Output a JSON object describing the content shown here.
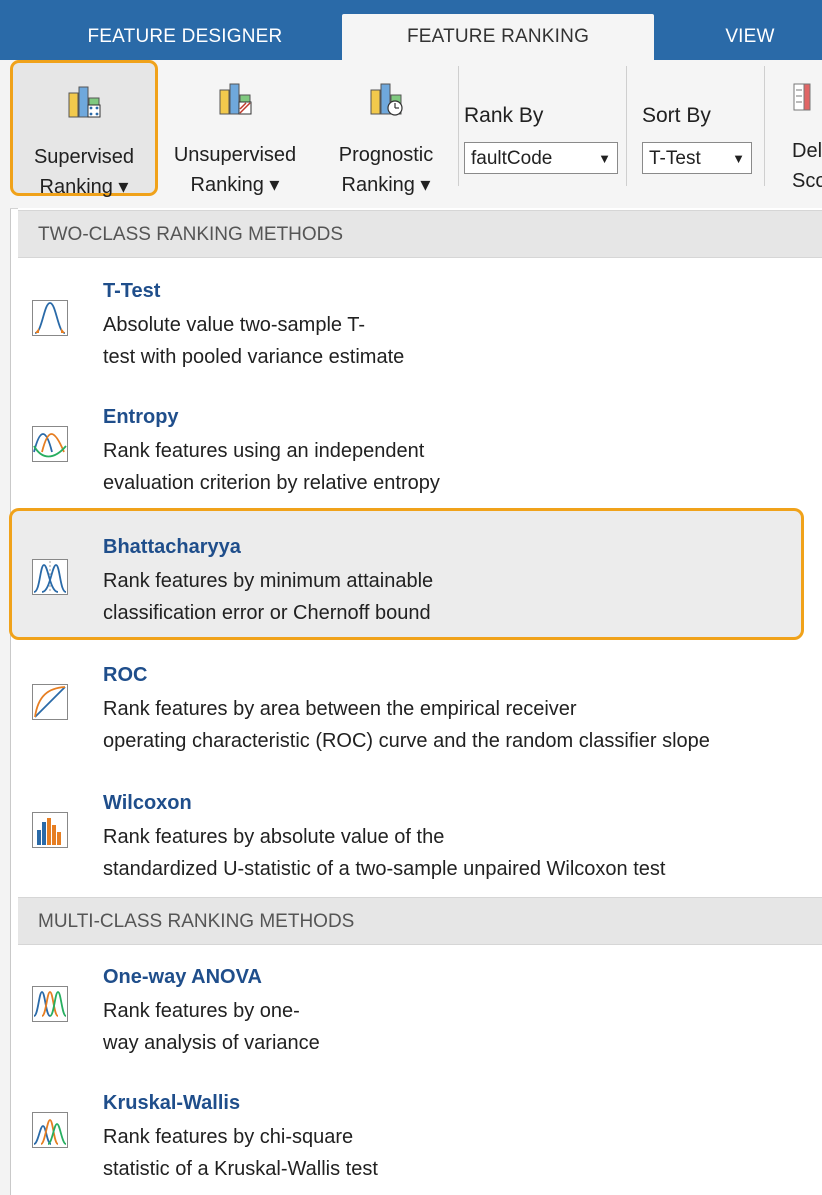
{
  "tabs": [
    "FEATURE DESIGNER",
    "FEATURE RANKING",
    "VIEW"
  ],
  "toolstrip": {
    "supervised": {
      "line1": "Supervised",
      "line2": "Ranking ▾"
    },
    "unsupervised": {
      "line1": "Unsupervised",
      "line2": "Ranking ▾"
    },
    "prognostic": {
      "line1": "Prognostic",
      "line2": "Ranking ▾"
    },
    "rank_by_label": "Rank By",
    "rank_by_value": "faultCode",
    "sort_by_label": "Sort By",
    "sort_by_value": "T-Test",
    "cut_button": {
      "line1": "Del",
      "line2": "Sco"
    }
  },
  "menu": {
    "section1": "TWO-CLASS RANKING METHODS",
    "section2": "MULTI-CLASS RANKING METHODS",
    "items": [
      {
        "title": "T-Test",
        "desc1": "Absolute value two-sample T-",
        "desc2": "test with pooled variance estimate",
        "icon": "t-test-icon"
      },
      {
        "title": "Entropy",
        "desc1": "Rank features using an independent",
        "desc2": "evaluation criterion by relative entropy",
        "icon": "entropy-icon"
      },
      {
        "title": "Bhattacharyya",
        "desc1": "Rank features by minimum attainable",
        "desc2": "classification error or Chernoff bound",
        "icon": "bhattacharyya-icon"
      },
      {
        "title": "ROC",
        "desc1": "Rank features by area between the empirical receiver",
        "desc2": "operating characteristic (ROC) curve and the random classifier slope",
        "icon": "roc-icon"
      },
      {
        "title": "Wilcoxon",
        "desc1": "Rank features by absolute value of the",
        "desc2": "standardized U-statistic of a two-sample unpaired Wilcoxon test",
        "icon": "wilcoxon-icon"
      },
      {
        "title": "One-way ANOVA",
        "desc1": "Rank features by one-",
        "desc2": "way analysis of variance",
        "icon": "anova-icon"
      },
      {
        "title": "Kruskal-Wallis",
        "desc1": "Rank features by chi-square",
        "desc2": "statistic of a Kruskal-Wallis test",
        "icon": "kruskal-wallis-icon"
      }
    ]
  },
  "colors": {
    "accent": "#f0a21a",
    "tabbar": "#2a6aa8",
    "title_blue": "#1f4e8b"
  }
}
